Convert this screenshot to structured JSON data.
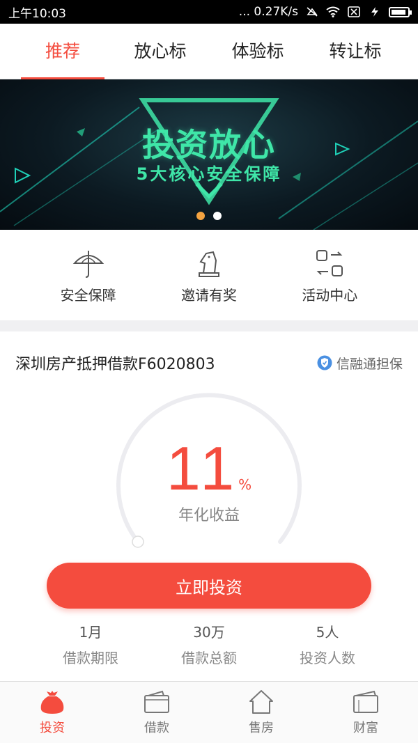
{
  "status_bar": {
    "time": "上午10:03",
    "network_speed": "... 0.27K/s"
  },
  "top_tabs": [
    {
      "label": "推荐",
      "active": true
    },
    {
      "label": "放心标",
      "active": false
    },
    {
      "label": "体验标",
      "active": false
    },
    {
      "label": "转让标",
      "active": false
    }
  ],
  "banner": {
    "title": "投资放心",
    "subtitle": "5大核心安全保障",
    "slide_count": 2,
    "active_slide": 1
  },
  "quick_menu": [
    {
      "label": "安全保障",
      "icon": "umbrella-icon"
    },
    {
      "label": "邀请有奖",
      "icon": "chess-knight-icon"
    },
    {
      "label": "活动中心",
      "icon": "switch-arrows-icon"
    }
  ],
  "product": {
    "title": "深圳房产抵押借款F6020803",
    "guarantee": "信融通担保",
    "rate": "11",
    "rate_unit": "%",
    "rate_label": "年化收益",
    "progress": 0.0,
    "button_label": "立即投资",
    "stats": [
      {
        "value": "1月",
        "label": "借款期限"
      },
      {
        "value": "30万",
        "label": "借款总额"
      },
      {
        "value": "5人",
        "label": "投资人数"
      }
    ]
  },
  "bottom_nav": [
    {
      "label": "投资",
      "icon": "money-bag-icon",
      "active": true
    },
    {
      "label": "借款",
      "icon": "wallet-icon",
      "active": false
    },
    {
      "label": "售房",
      "icon": "house-icon",
      "active": false
    },
    {
      "label": "财富",
      "icon": "purse-icon",
      "active": false
    }
  ],
  "colors": {
    "accent": "#f44c3e",
    "banner_text": "#3fe6a8",
    "dot_active": "#f4a340"
  }
}
